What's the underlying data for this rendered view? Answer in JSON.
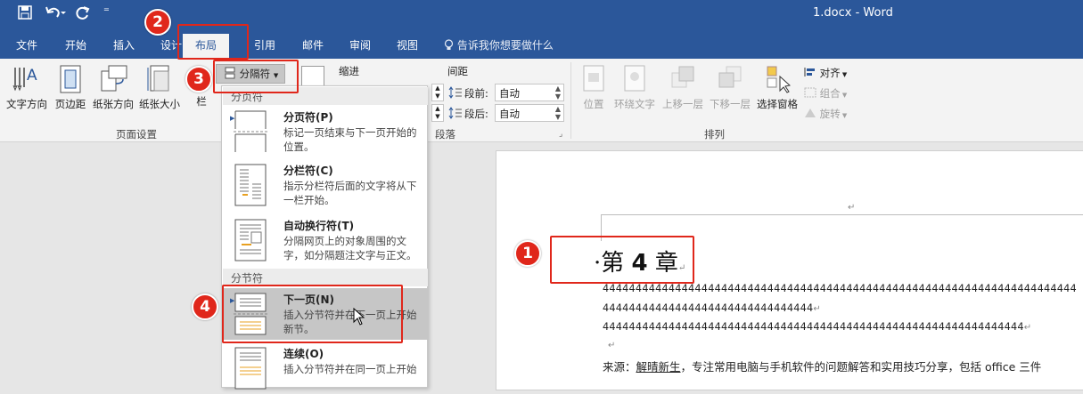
{
  "title_bar": {
    "title": "1.docx  -  Word",
    "save_icon": "save-icon",
    "undo_icon": "undo-icon",
    "redo_icon": "redo-icon",
    "qat_more": "⁼"
  },
  "tabs": [
    "文件",
    "开始",
    "插入",
    "设计",
    "布局",
    "引用",
    "邮件",
    "审阅",
    "视图"
  ],
  "tell_me": "告诉我你想要做什么",
  "ribbon": {
    "page_setup": {
      "buttons": [
        "文字方向",
        "页边距",
        "纸张方向",
        "纸张大小",
        "栏"
      ],
      "group_label": "页面设置"
    },
    "breaks_button": "分隔符",
    "indent_label": "缩进",
    "spacing_label": "间距",
    "spacing_before_label": "段前:",
    "spacing_before_value": "自动",
    "spacing_after_label": "段后:",
    "spacing_after_value": "自动",
    "paragraph_group_label": "段落",
    "arrange": {
      "buttons": [
        "位置",
        "环绕文字",
        "上移一层",
        "下移一层",
        "选择窗格"
      ],
      "align": "对齐",
      "group": "组合",
      "rotate": "旋转",
      "group_label": "排列"
    }
  },
  "breaks_menu": {
    "page_breaks_header": "分页符",
    "section_breaks_header": "分节符",
    "items": [
      {
        "title": "分页符(P)",
        "desc": "标记一页结束与下一页开始的位置。"
      },
      {
        "title": "分栏符(C)",
        "desc": "指示分栏符后面的文字将从下一栏开始。"
      },
      {
        "title": "自动换行符(T)",
        "desc": "分隔网页上的对象周围的文字，如分隔题注文字与正文。"
      },
      {
        "title": "下一页(N)",
        "desc": "插入分节符并在下一页上开始新节。"
      },
      {
        "title": "连续(O)",
        "desc": "插入分节符并在同一页上开始"
      }
    ]
  },
  "document": {
    "chapter_prefix": "第 ",
    "chapter_num": "4",
    "chapter_suffix": " 章",
    "line1": "444444444444444444444444444444444444444444444444444444444444444444444444",
    "line2": "44444444444444444444444444444444",
    "line3": "4444444444444444444444444444444444444444444444444444444444444444",
    "line4_prefix": "来源：",
    "line4_link": "解晴新生",
    "line4_rest": "，专注常用电脑与手机软件的问题解答和实用技巧分享，包括 office 三件",
    "para_mark": "↵"
  },
  "badges": [
    "1",
    "2",
    "3",
    "4"
  ],
  "colors": {
    "accent": "#2b579a",
    "highlight": "#e0271b"
  }
}
